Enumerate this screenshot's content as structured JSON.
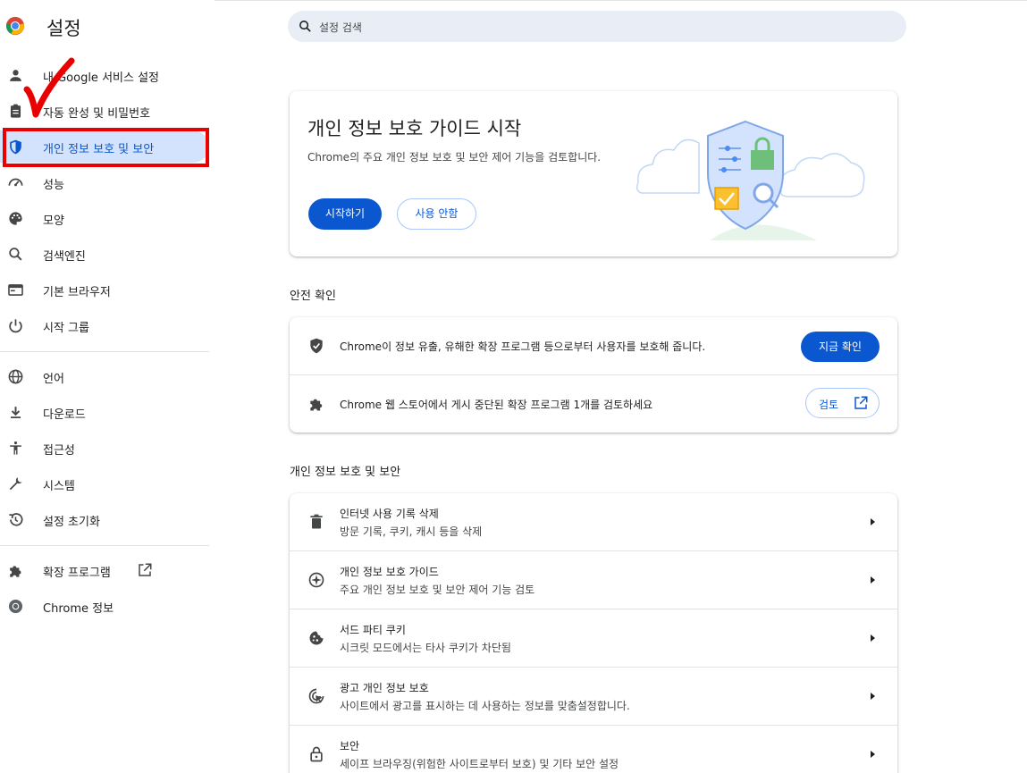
{
  "header": {
    "title": "설정",
    "search_placeholder": "설정 검색"
  },
  "sidebar": {
    "items": [
      {
        "label": "내 Google 서비스 설정",
        "icon": "person-icon"
      },
      {
        "label": "자동 완성 및 비밀번호",
        "icon": "clipboard-icon"
      },
      {
        "label": "개인 정보 보호 및 보안",
        "icon": "shield-icon",
        "active": true
      },
      {
        "label": "성능",
        "icon": "speedometer-icon"
      },
      {
        "label": "모양",
        "icon": "palette-icon"
      },
      {
        "label": "검색엔진",
        "icon": "search-icon"
      },
      {
        "label": "기본 브라우저",
        "icon": "browser-icon"
      },
      {
        "label": "시작 그룹",
        "icon": "power-icon"
      },
      {
        "label": "언어",
        "icon": "globe-icon"
      },
      {
        "label": "다운로드",
        "icon": "download-icon"
      },
      {
        "label": "접근성",
        "icon": "accessibility-icon"
      },
      {
        "label": "시스템",
        "icon": "wrench-icon"
      },
      {
        "label": "설정 초기화",
        "icon": "history-icon"
      },
      {
        "label": "확장 프로그램",
        "icon": "puzzle-icon"
      },
      {
        "label": "Chrome 정보",
        "icon": "chrome-icon"
      }
    ]
  },
  "guide": {
    "title": "개인 정보 보호 가이드 시작",
    "description": "Chrome의 주요 개인 정보 보호 및 보안 제어 기능을 검토합니다.",
    "start_label": "시작하기",
    "dismiss_label": "사용 안함"
  },
  "safety": {
    "section_title": "안전 확인",
    "rows": [
      {
        "text": "Chrome이 정보 유출, 유해한 확장 프로그램 등으로부터 사용자를 보호해 줍니다.",
        "button": "지금 확인",
        "icon": "shield-icon"
      },
      {
        "text": "Chrome 웹 스토어에서 게시 중단된 확장 프로그램 1개를 검토하세요",
        "button": "검토",
        "icon": "puzzle-icon"
      }
    ]
  },
  "privacy": {
    "section_title": "개인 정보 보호 및 보안",
    "rows": [
      {
        "title": "인터넷 사용 기록 삭제",
        "subtitle": "방문 기록, 쿠키, 캐시 등을 삭제",
        "icon": "trash-icon"
      },
      {
        "title": "개인 정보 보호 가이드",
        "subtitle": "주요 개인 정보 보호 및 보안 제어 기능 검토",
        "icon": "compass-icon"
      },
      {
        "title": "서드 파티 쿠키",
        "subtitle": "시크릿 모드에서는 타사 쿠키가 차단됨",
        "icon": "cookie-icon"
      },
      {
        "title": "광고 개인 정보 보호",
        "subtitle": "사이트에서 광고를 표시하는 데 사용하는 정보를 맞춤설정합니다.",
        "icon": "ad-privacy-icon"
      },
      {
        "title": "보안",
        "subtitle": "세이프 브라우징(위험한 사이트로부터 보호) 및 기타 보안 설정",
        "icon": "lock-icon"
      }
    ]
  },
  "colors": {
    "accent": "#0b57d0",
    "active_nav_bg": "#d3e3fd",
    "annotation_red": "#ea0000"
  }
}
